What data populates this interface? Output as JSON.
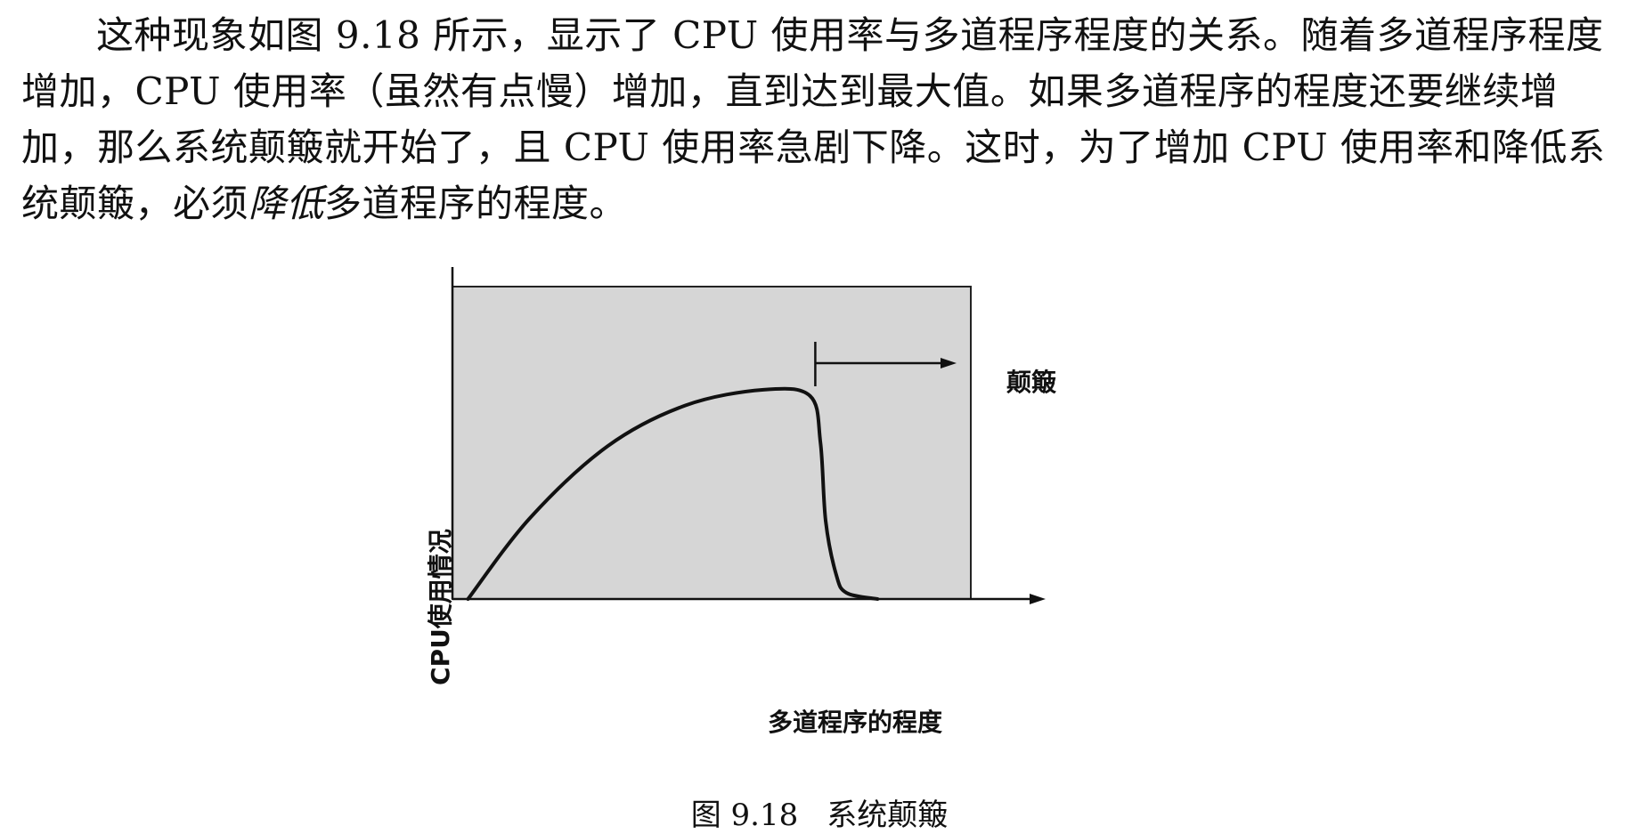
{
  "paragraph": {
    "part1": "这种现象如图 9.18 所示，显示了 CPU 使用率与多道程序程度的关系。随着多道程序程度增加，CPU 使用率（虽然有点慢）增加，直到达到最大值。如果多道程序的程度还要继续增加，那么系统颠簸就开始了，且 CPU 使用率急剧下降。这时，为了增加 CPU 使用率和降低系统颠簸，必须",
    "emphasis": "降低",
    "part2": "多道程序的程度。"
  },
  "figure": {
    "caption_number": "图 9.18",
    "caption_text": "系统颠簸"
  },
  "chart_data": {
    "type": "line",
    "xlabel": "多道程序的程度",
    "ylabel": "CPU使用情况",
    "annotation": "颠簸",
    "xlim": [
      0,
      10
    ],
    "ylim": [
      0,
      10
    ],
    "series": [
      {
        "x": [
          0.3,
          1.5,
          3.0,
          4.5,
          6.0,
          6.9,
          7.1,
          7.2,
          7.4,
          7.6,
          8.2
        ],
        "y": [
          0.0,
          2.6,
          4.9,
          6.2,
          6.7,
          6.5,
          5.0,
          2.5,
          0.8,
          0.2,
          0.0
        ]
      }
    ],
    "thrashing_start_x": 7.0,
    "grid": false,
    "legend": "none",
    "colors": {
      "plot_background": "#d6d6d6",
      "curve": "#111111"
    }
  }
}
